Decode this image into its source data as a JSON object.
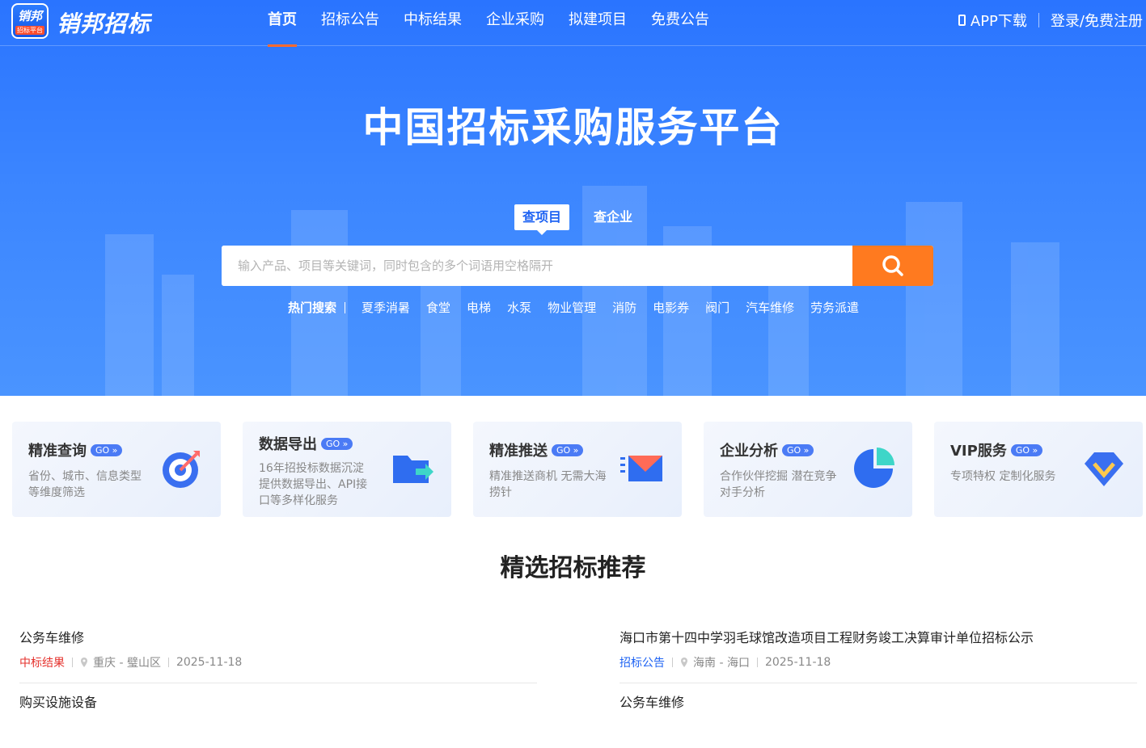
{
  "brand": {
    "logo_top": "销邦",
    "logo_bottom": "招标平台",
    "name": "销邦招标"
  },
  "nav": {
    "items": [
      "首页",
      "招标公告",
      "中标结果",
      "企业采购",
      "拟建项目",
      "免费公告"
    ],
    "app": "APP下载",
    "login": "登录/免费注册"
  },
  "hero": {
    "title": "中国招标采购服务平台"
  },
  "search": {
    "tabs": [
      "查项目",
      "查企业"
    ],
    "placeholder": "输入产品、项目等关键词，同时包含的多个词语用空格隔开"
  },
  "hot": {
    "label": "热门搜索",
    "keywords": [
      "夏季消暑",
      "食堂",
      "电梯",
      "水泵",
      "物业管理",
      "消防",
      "电影券",
      "阀门",
      "汽车维修",
      "劳务派遣"
    ]
  },
  "cards": [
    {
      "title": "精准查询",
      "go": "GO »",
      "desc": "省份、城市、信息类型等维度筛选",
      "icon": "target-icon"
    },
    {
      "title": "数据导出",
      "go": "GO »",
      "desc": "16年招投标数据沉淀 提供数据导出、API接口等多样化服务",
      "icon": "folder-export-icon"
    },
    {
      "title": "精准推送",
      "go": "GO »",
      "desc": "精准推送商机 无需大海捞针",
      "icon": "mail-icon"
    },
    {
      "title": "企业分析",
      "go": "GO »",
      "desc": "合作伙伴挖掘 潜在竞争对手分析",
      "icon": "pie-chart-icon"
    },
    {
      "title": "VIP服务",
      "go": "GO »",
      "desc": "专项特权 定制化服务",
      "icon": "diamond-icon"
    }
  ],
  "section": {
    "title": "精选招标推荐"
  },
  "listings_left": [
    {
      "title": "公务车维修",
      "tag": "中标结果",
      "region": "重庆 - 璧山区",
      "date": "2025-11-18"
    },
    {
      "title": "购买设施设备"
    }
  ],
  "listings_right": [
    {
      "title": "海口市第十四中学羽毛球馆改造项目工程财务竣工决算审计单位招标公示",
      "tag": "招标公告",
      "region": "海南 - 海口",
      "date": "2025-11-18"
    },
    {
      "title": "公务车维修"
    }
  ],
  "colors": {
    "primary": "#2a74ff",
    "accent": "#ff7a1f",
    "tag_red": "#e5322d",
    "tag_blue": "#1e63f3"
  }
}
